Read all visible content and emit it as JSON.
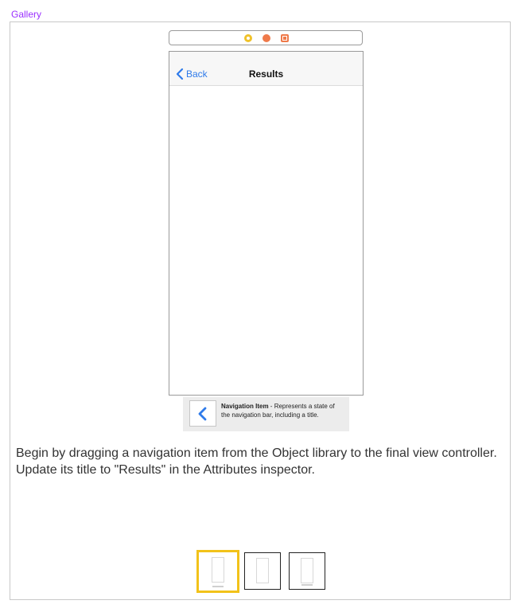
{
  "gallery": {
    "label": "Gallery"
  },
  "scene_dock": {
    "icons": [
      "view-controller-icon",
      "first-responder-icon",
      "exit-icon"
    ],
    "colors": {
      "view_controller": "#f0c22a",
      "first_responder": "#ef7a4a",
      "exit": "#ef7a4a"
    }
  },
  "phone": {
    "navbar": {
      "back_label": "Back",
      "title": "Results"
    }
  },
  "library_item": {
    "name": "Navigation Item",
    "description": " - Represents a state of the navigation bar, including a title.",
    "icon": "chevron-left-icon"
  },
  "instruction": {
    "text": "Begin by dragging a navigation item from the Object library to the final view controller. Update its title to \"Results\" in the Attributes inspector."
  },
  "thumbnails": {
    "count": 3,
    "selected_index": 0,
    "accent": "#f2c21a"
  },
  "colors": {
    "accent_label": "#9b30ff",
    "link_blue": "#2f7bea"
  }
}
